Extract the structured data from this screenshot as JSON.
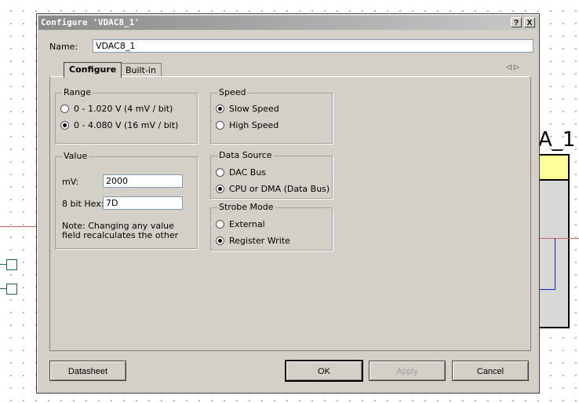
{
  "background": {
    "component_label": "A_1"
  },
  "dialog": {
    "title": "Configure 'VDAC8_1'",
    "help_label": "?",
    "close_label": "X",
    "name_label": "Name:",
    "name_value": "VDAC8_1",
    "tabs": [
      {
        "label": "Configure",
        "active": true
      },
      {
        "label": "Built-in",
        "active": false
      }
    ],
    "tab_nav_icons": "◁ ▷",
    "range": {
      "legend": "Range",
      "options": [
        {
          "label": "0 - 1.020 V (4 mV / bit)",
          "selected": false
        },
        {
          "label": "0 - 4.080 V (16 mV / bit)",
          "selected": true
        }
      ]
    },
    "value": {
      "legend": "Value",
      "mv_label": "mV:",
      "mv_value": "2000",
      "hex_label": "8 bit Hex:",
      "hex_value": "7D",
      "note": "Note: Changing any value field recalculates the other"
    },
    "speed": {
      "legend": "Speed",
      "options": [
        {
          "label": "Slow Speed",
          "selected": true
        },
        {
          "label": "High Speed",
          "selected": false
        }
      ]
    },
    "data_source": {
      "legend": "Data Source",
      "options": [
        {
          "label": "DAC Bus",
          "selected": false
        },
        {
          "label": "CPU or DMA (Data Bus)",
          "selected": true
        }
      ]
    },
    "strobe_mode": {
      "legend": "Strobe Mode",
      "options": [
        {
          "label": "External",
          "selected": false
        },
        {
          "label": "Register Write",
          "selected": true
        }
      ]
    },
    "buttons": {
      "datasheet": "Datasheet",
      "ok": "OK",
      "apply": "Apply",
      "cancel": "Cancel"
    }
  }
}
